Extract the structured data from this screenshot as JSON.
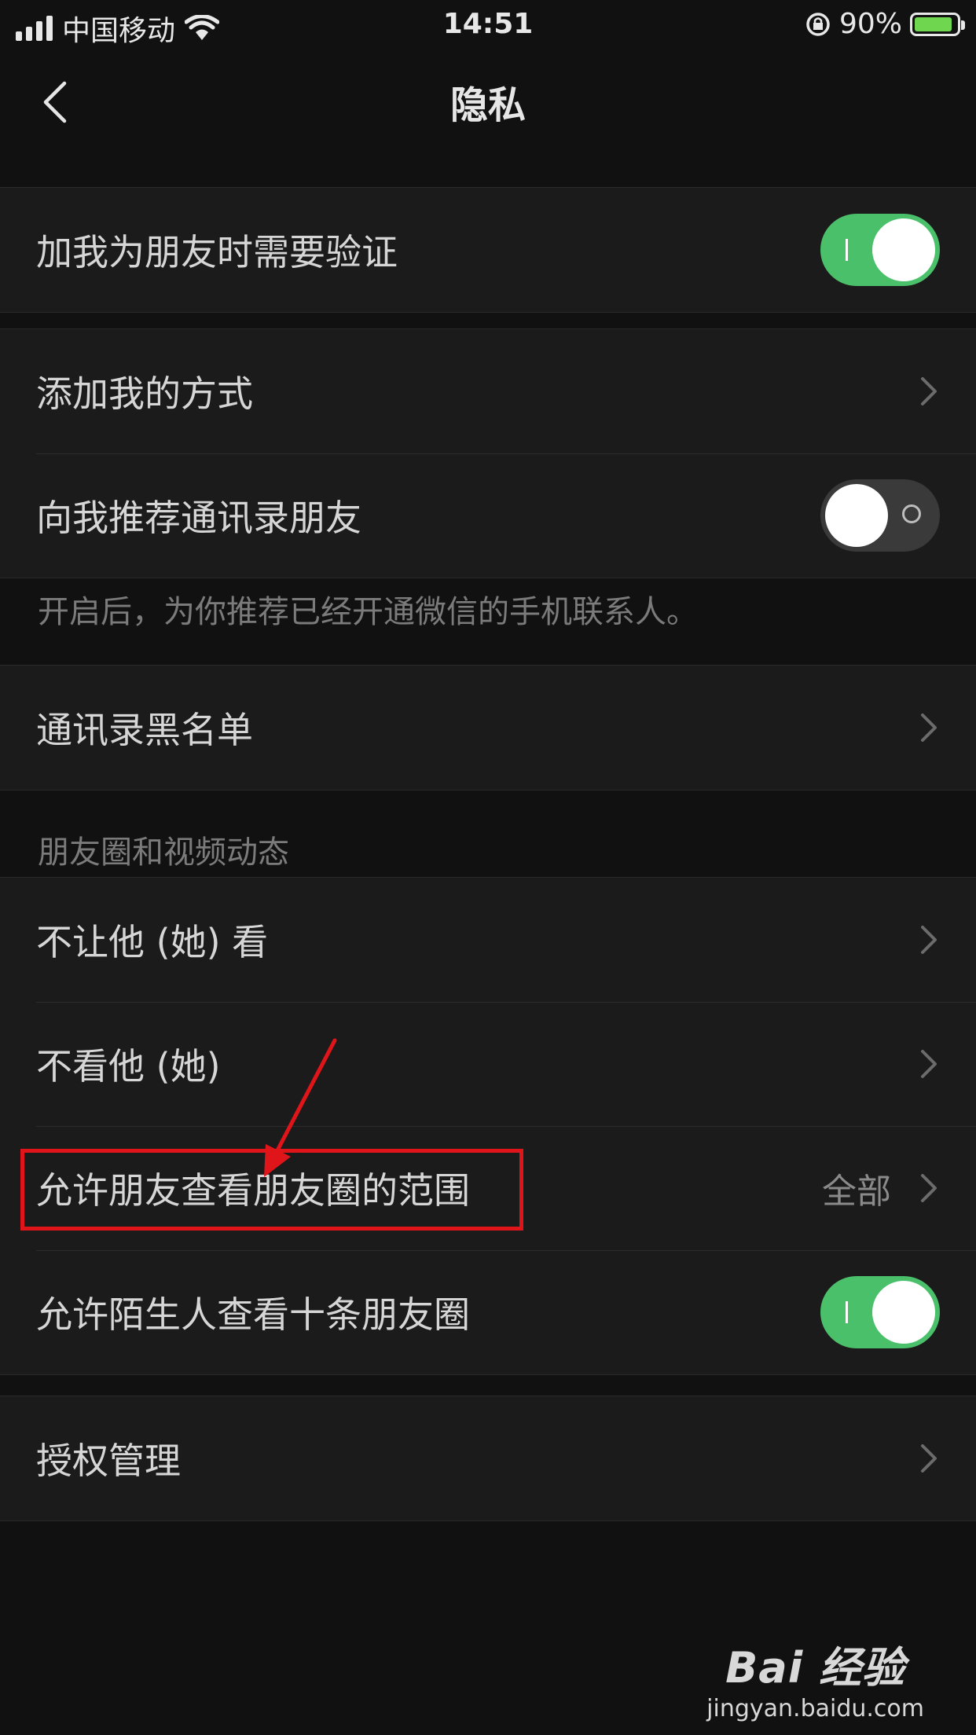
{
  "status_bar": {
    "carrier": "中国移动",
    "time": "14:51",
    "battery": "90%",
    "battery_level": 0.9
  },
  "nav": {
    "title": "隐私"
  },
  "groups": {
    "verify": {
      "label": "加我为朋友时需要验证",
      "toggle_on": true
    },
    "add_methods": {
      "label": "添加我的方式"
    },
    "recommend_contacts": {
      "label": "向我推荐通讯录朋友",
      "toggle_on": false,
      "hint": "开启后，为你推荐已经开通微信的手机联系人。"
    },
    "blacklist": {
      "label": "通讯录黑名单"
    },
    "moments": {
      "header": "朋友圈和视频动态",
      "items": [
        {
          "label": "不让他 (她) 看"
        },
        {
          "label": "不看他 (她)"
        },
        {
          "label": "允许朋友查看朋友圈的范围",
          "value": "全部"
        },
        {
          "label": "允许陌生人查看十条朋友圈",
          "toggle_on": true
        }
      ]
    },
    "authorization": {
      "label": "授权管理"
    }
  },
  "colors": {
    "background": "#111111",
    "row_bg": "#1b1b1b",
    "toggle_on": "#4bc06a",
    "annotation": "#e0151a"
  },
  "watermark": {
    "brand": "Bai 经验",
    "url": "jingyan.baidu.com"
  }
}
